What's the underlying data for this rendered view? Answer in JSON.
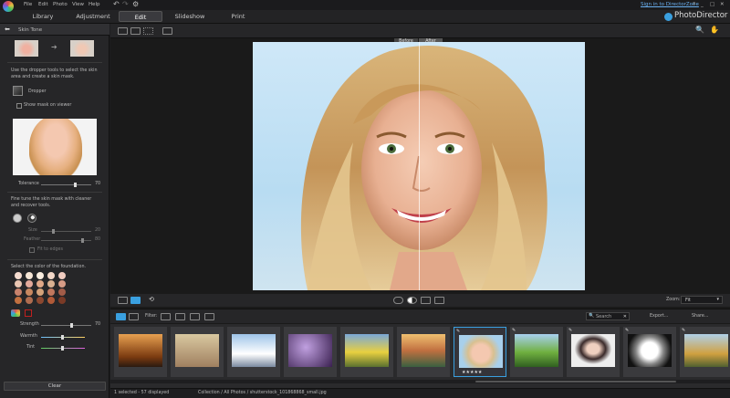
{
  "menu": {
    "file": "File",
    "edit": "Edit",
    "photo": "Photo",
    "view": "View",
    "help": "Help",
    "signin": "Sign in to DirectorZone",
    "help_q": "?"
  },
  "tabs": {
    "library": "Library",
    "adjustment": "Adjustment",
    "edit": "Edit",
    "slideshow": "Slideshow",
    "print": "Print"
  },
  "app_name": "PhotoDirector",
  "panel": {
    "title": "Skin Tone",
    "instructions": "Use the dropper tools to select the skin area and create a skin mask.",
    "dropper": "Dropper",
    "show_mask": "Show mask on viewer",
    "tolerance_label": "Tolerance",
    "tolerance_value": "70",
    "tolerance": 0.7,
    "fine_tune": "Fine tune the skin mask with cleaner and recover tools.",
    "size_label": "Size",
    "size_value": "20",
    "feather_label": "Feather",
    "feather_value": "80",
    "fit_edges": "Fit to edges",
    "select_color": "Select the color of the foundation.",
    "strength_label": "Strength",
    "strength_value": "70",
    "warmth_label": "Warmth",
    "tint_label": "Tint",
    "clear": "Clear"
  },
  "viewer": {
    "before": "Before",
    "after": "After",
    "zoom_label": "Zoom:",
    "zoom_value": "Fit"
  },
  "filmstrip": {
    "filter": "Filter:",
    "search_placeholder": "Search",
    "export": "Export...",
    "share": "Share...",
    "rating": "★★★★★"
  },
  "status": {
    "selection": "1 selected - 57 displayed",
    "path": "Collection / All Photos / shutterstock_101868868_small.jpg"
  },
  "colors": {
    "accent": "#3aa0e0",
    "swatches": [
      "#f5dcd0",
      "#f7e6d6",
      "#fbeee0",
      "#f3d8c8",
      "#f0ccc0",
      "#eac6b2",
      "#e3a99a",
      "#e0a888",
      "#d9b192",
      "#d79c86",
      "#c8826c",
      "#c98860",
      "#d4a27a",
      "#c0785e",
      "#a35c48",
      "#c27040",
      "#b06d50",
      "#8c4830",
      "#b15a38",
      "#7a3a26"
    ]
  }
}
